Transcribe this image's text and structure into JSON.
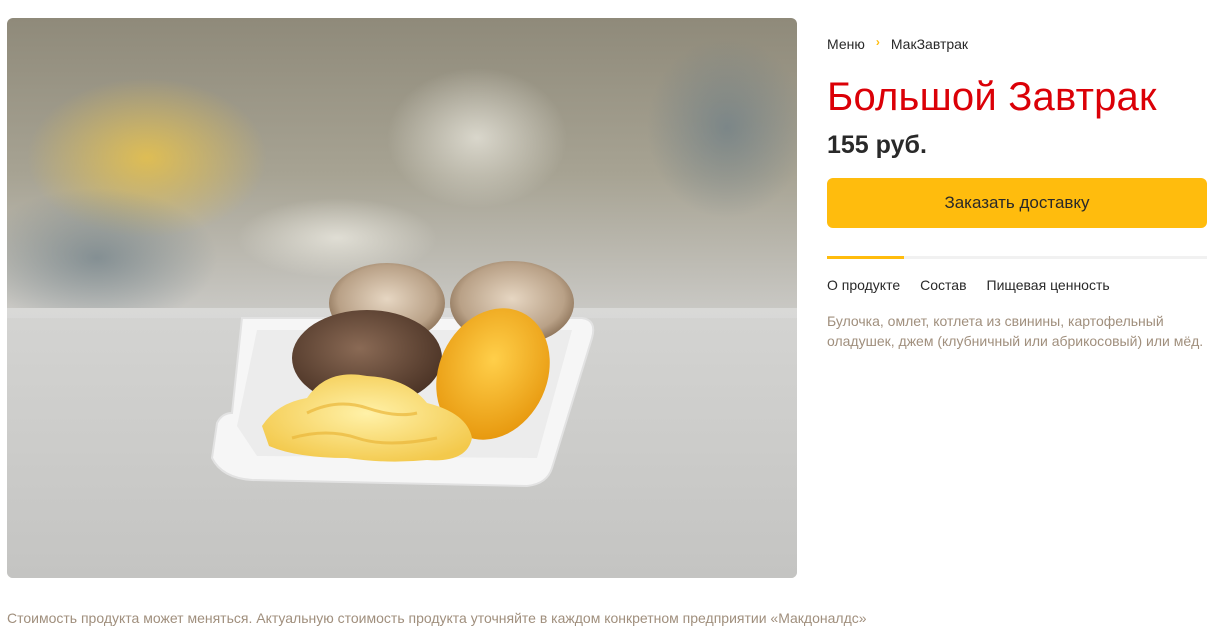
{
  "breadcrumb": {
    "menu_label": "Меню",
    "separator": "›",
    "category_label": "МакЗавтрак"
  },
  "product": {
    "title": "Большой Завтрак",
    "price": "155 руб.",
    "order_button_label": "Заказать доставку"
  },
  "tabs": [
    {
      "label": "О продукте",
      "active": true
    },
    {
      "label": "Состав",
      "active": false
    },
    {
      "label": "Пищевая ценность",
      "active": false
    }
  ],
  "description": "Булочка, омлет, котлета из свинины, картофельный оладушек, джем (клубничный или абрикосовый) или мёд.",
  "footnote": "Стоимость продукта может меняться. Актуальную стоимость продукта уточняйте в каждом конкретном предприятии «Макдоналдс»",
  "colors": {
    "accent_yellow": "#ffbc0d",
    "title_red": "#db0007",
    "muted_text": "#a08f7d",
    "body_text": "#292929"
  }
}
